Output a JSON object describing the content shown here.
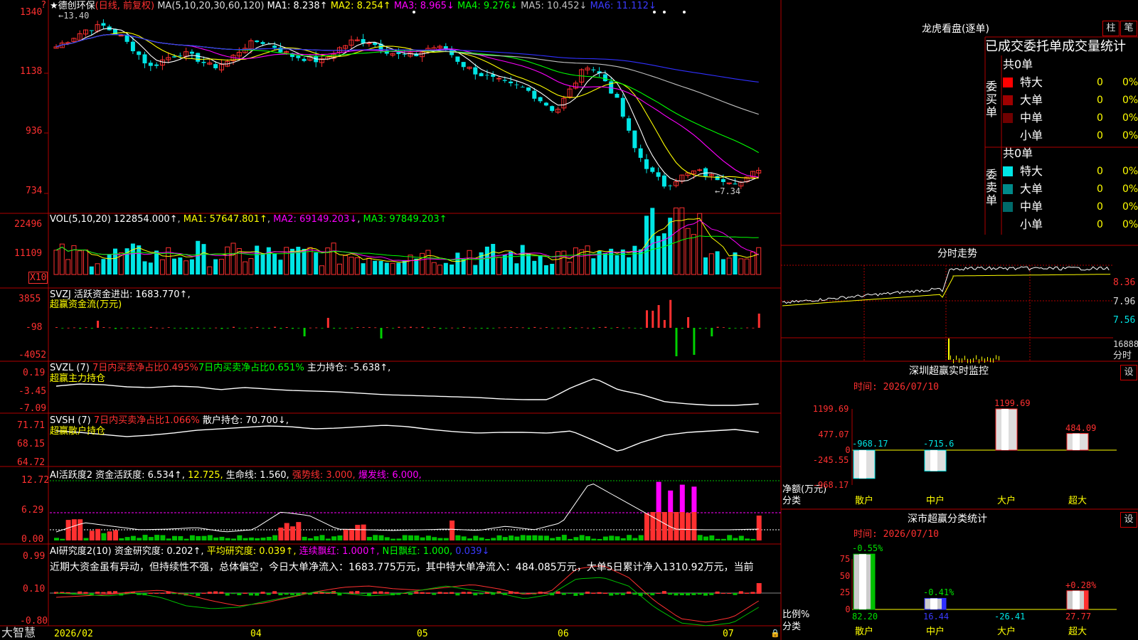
{
  "colors": {
    "up": "#ff3030",
    "down": "#00e5e5",
    "ma1": "#ffffff",
    "ma2": "#ffff00",
    "ma3": "#ff00ff",
    "ma4": "#00ff00",
    "ma5": "#c0c0c0",
    "ma6": "#3030ff",
    "grid": "#b00000"
  },
  "app": {
    "name": "大智慧"
  },
  "price_panel": {
    "title": "★德创环保",
    "mode": "(日线, 前复权)",
    "ma_params": "MA(5,10,20,30,60,120)",
    "ma1": "MA1: 8.238↑",
    "ma2": "MA2: 8.254↑",
    "ma3": "MA3: 8.965↓",
    "ma4": "MA4: 9.276↓",
    "ma5": "MA5: 10.452↓",
    "ma6": "MA6: 11.112↓",
    "axis": [
      "1340",
      "1138",
      "936",
      "734"
    ],
    "high_label": "←13.40",
    "low_label": "←7.34",
    "question": "?"
  },
  "vol_panel": {
    "label": "VOL(5,10,20) 122854.000↑",
    "ma1": "MA1: 57647.801↑",
    "ma2": "MA2: 69149.203↓",
    "ma3": "MA3: 97849.203↑",
    "axis": [
      "22496",
      "11109"
    ],
    "unit": "X10"
  },
  "svzj_panel": {
    "label": "SVZJ  活跃资金进出: 1683.770↑,",
    "sub": "超赢资金流(万元)",
    "axis": [
      "3855",
      "-98",
      "-4052"
    ]
  },
  "svzl_panel": {
    "label": "SVZL (7)",
    "red1": "7日内买卖净占比0.495%",
    "green1": "7日内买卖净占比0.651%",
    "white1": "主力持仓: -5.638↑,",
    "sub": "超赢主力持仓",
    "axis": [
      "0.19",
      "-3.45",
      "-7.09"
    ]
  },
  "svsh_panel": {
    "label": "SVSH (7)",
    "red1": "7日内买卖净占比1.066%",
    "white1": "散户持仓: 70.700↓,",
    "sub": "超赢散户持仓",
    "axis": [
      "71.71",
      "68.15",
      "64.72"
    ]
  },
  "ai2_panel": {
    "label": "AI活跃度2 资金活跃度: 6.534↑,",
    "v2": "12.725,",
    "v3": "生命线: 1.560,",
    "v4": "强势线: 3.000,",
    "v5": "爆发线: 6.000,",
    "axis": [
      "12.72",
      "6.29",
      "0.00"
    ]
  },
  "ai3_panel": {
    "label": "AI研究度2(10) 资金研究度: 0.202↑,",
    "v2": "平均研究度: 0.039↑,",
    "v3": "连续飘红: 1.000↑,",
    "v4": "N日飘红: 1.000,",
    "v5": "0.039↓",
    "text": "近期大资金虽有异动，但持续性不强，总体偏空，今日大单净流入：1683.775万元，其中特大单净流入：484.085万元，大单5日累计净入1310.92万元，当前",
    "axis": [
      "0.99",
      "0.10",
      "-0.80"
    ]
  },
  "date_axis": [
    "2026/02",
    "04",
    "05",
    "06",
    "07"
  ],
  "lhb": {
    "title": "龙虎看盘(逐单)",
    "btn1": "柱",
    "btn2": "笔",
    "header": "已成交委托单成交量统计",
    "buy_side": "委买单",
    "sell_side": "委卖单",
    "buy_total": "共0单",
    "sell_total": "共0单",
    "buy_rows": [
      {
        "label": "特大",
        "v": "0",
        "p": "0%"
      },
      {
        "label": "大单",
        "v": "0",
        "p": "0%"
      },
      {
        "label": "中单",
        "v": "0",
        "p": "0%"
      },
      {
        "label": "小单",
        "v": "0",
        "p": "0%"
      }
    ],
    "sell_rows": [
      {
        "label": "特大",
        "v": "0",
        "p": "0%"
      },
      {
        "label": "大单",
        "v": "0",
        "p": "0%"
      },
      {
        "label": "中单",
        "v": "0",
        "p": "0%"
      },
      {
        "label": "小单",
        "v": "0",
        "p": "0%"
      }
    ]
  },
  "intraday": {
    "title": "分时走势",
    "axis": [
      "8.36",
      "7.96",
      "7.56",
      "16888"
    ],
    "unit": "分时"
  },
  "sz_monitor": {
    "title": "深圳超赢实时监控",
    "set": "设",
    "time": "时间: 2026/07/10",
    "axis": [
      "1199.69",
      "477.07",
      "0",
      "-245.55",
      "-968.17"
    ],
    "row_label1": "净额(万元)",
    "row_label2": "分类",
    "bars": [
      {
        "name": "散户",
        "value": -968.17,
        "label": "-968.17"
      },
      {
        "name": "中户",
        "value": -715.6,
        "label": "-715.6"
      },
      {
        "name": "大户",
        "value": 1199.69,
        "label": "1199.69"
      },
      {
        "name": "超大",
        "value": 484.09,
        "label": "484.09"
      }
    ]
  },
  "sz_class": {
    "title": "深市超赢分类统计",
    "set": "设",
    "time": "时间: 2026/07/10",
    "axis": [
      "75",
      "50",
      "25",
      "0"
    ],
    "row_label1": "比例%",
    "row_label2": "分类",
    "bars": [
      {
        "name": "散户",
        "value": 82.2,
        "top": "-0.55%",
        "bottom": "82.20"
      },
      {
        "name": "中户",
        "value": 16.44,
        "top": "-0.41%",
        "bottom": "16.44"
      },
      {
        "name": "大户",
        "value": -26.41,
        "top": "",
        "bottom": "-26.41"
      },
      {
        "name": "超大",
        "value": 27.77,
        "top": "+0.28%",
        "bottom": "27.77"
      }
    ]
  }
}
